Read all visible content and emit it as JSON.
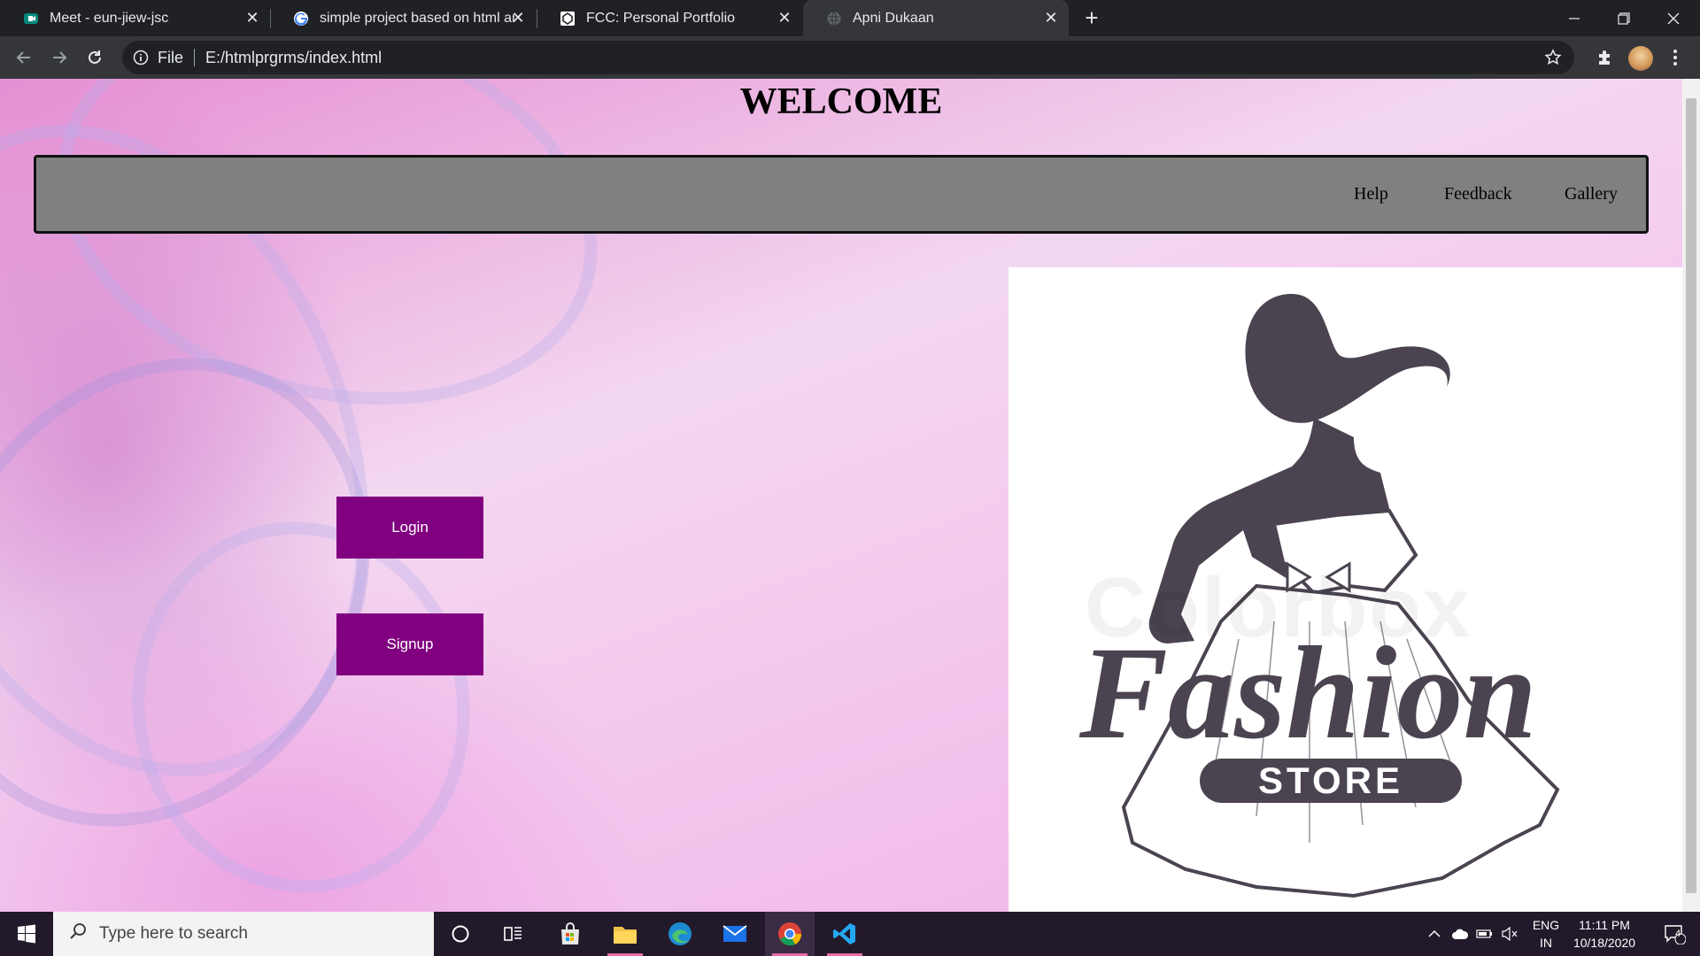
{
  "browser": {
    "tabs": [
      {
        "title": "Meet - eun-jiew-jsc",
        "icon": "meet-icon"
      },
      {
        "title": "simple project based on html and",
        "icon": "google-icon"
      },
      {
        "title": "FCC: Personal Portfolio",
        "icon": "codepen-icon"
      },
      {
        "title": "Apni Dukaan",
        "icon": "globe-icon",
        "active": true
      }
    ],
    "address": {
      "scheme": "File",
      "url": "E:/htmlprgrms/index.html"
    }
  },
  "page": {
    "heading": "WELCOME",
    "nav": {
      "help": "Help",
      "feedback": "Feedback",
      "gallery": "Gallery"
    },
    "buttons": {
      "login": "Login",
      "signup": "Signup"
    },
    "hero": {
      "watermark": "Colorbox",
      "brand_word": "Fashion",
      "brand_tag": "STORE"
    },
    "colors": {
      "button_bg": "#800080",
      "navbar_bg": "#808080"
    }
  },
  "taskbar": {
    "search_placeholder": "Type here to search",
    "language": {
      "line1": "ENG",
      "line2": "IN"
    },
    "clock": {
      "time": "11:11 PM",
      "date": "10/18/2020"
    },
    "notification_count": "4"
  }
}
